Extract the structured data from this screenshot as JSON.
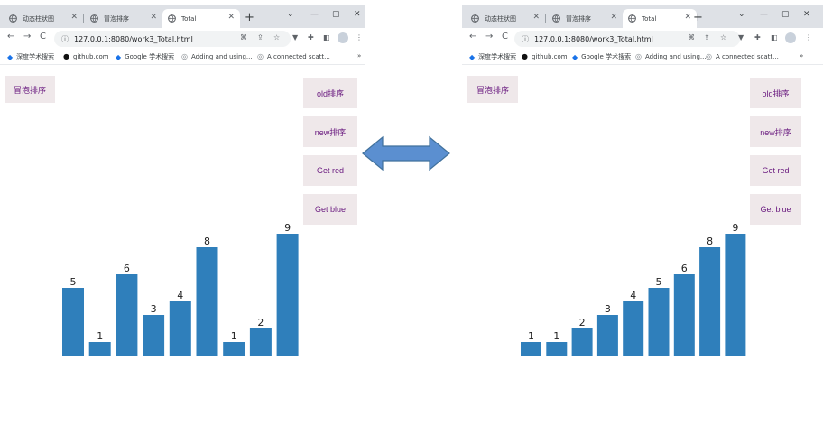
{
  "left_window": {
    "tabs": [
      {
        "title": "动态柱状图"
      },
      {
        "title": "冒泡排序"
      },
      {
        "title": "Total"
      }
    ],
    "url": "127.0.0.1:8080/work3_Total.html",
    "bookmarks": [
      {
        "label": "深度学术搜索",
        "icon": "diamond-icon"
      },
      {
        "label": "github.com",
        "icon": "github-icon"
      },
      {
        "label": "Google 学术搜索",
        "icon": "diamond-icon"
      },
      {
        "label": "Adding and using...",
        "icon": "page-icon"
      },
      {
        "label": "A connected scatt...",
        "icon": "page-icon"
      }
    ],
    "buttons": {
      "bubble": "冒泡排序",
      "old": "old排序",
      "new": "new排序",
      "red": "Get red",
      "blue": "Get blue"
    },
    "chart_data": {
      "type": "bar",
      "values": [
        5,
        1,
        6,
        3,
        4,
        8,
        1,
        2,
        9
      ],
      "color": "#2f7fbb"
    }
  },
  "right_window": {
    "tabs": [
      {
        "title": "动态柱状图"
      },
      {
        "title": "冒泡排序"
      },
      {
        "title": "Total"
      }
    ],
    "url": "127.0.0.1:8080/work3_Total.html",
    "bookmarks": [
      {
        "label": "深度学术搜索",
        "icon": "diamond-icon"
      },
      {
        "label": "github.com",
        "icon": "github-icon"
      },
      {
        "label": "Google 学术搜索",
        "icon": "diamond-icon"
      },
      {
        "label": "Adding and using...",
        "icon": "page-icon"
      },
      {
        "label": "A connected scatt...",
        "icon": "page-icon"
      }
    ],
    "buttons": {
      "bubble": "冒泡排序",
      "old": "old排序",
      "new": "new排序",
      "red": "Get red",
      "blue": "Get blue"
    },
    "chart_data": {
      "type": "bar",
      "values": [
        1,
        1,
        2,
        3,
        4,
        5,
        6,
        8,
        9
      ],
      "color": "#2f7fbb"
    }
  },
  "arrow_color": "#5b8fd0"
}
